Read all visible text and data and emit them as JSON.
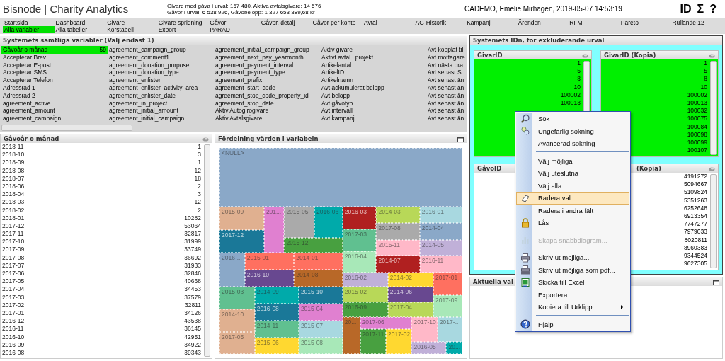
{
  "header": {
    "title": "Bisnode | Charity Analytics",
    "stats": [
      "Givare med gåva i urval: 167 480, Aktiva avtalsgivare: 14 576",
      "Gåvor i urval: 6 538 926, Gåvobelopp: 1 327 653 389,68 kr"
    ],
    "user": "CADEMO, Emelie Mirhagen, 2019-05-07 14:53:19",
    "tools": [
      "ID",
      "Σ",
      "?"
    ]
  },
  "tabs": [
    {
      "label": "Startsida",
      "selected": false
    },
    {
      "label": "Dashboard",
      "selected": false
    },
    {
      "label": "Givare",
      "selected": false
    },
    {
      "label": "Givare spridning",
      "selected": false
    },
    {
      "label": "Gåvor",
      "selected": false
    },
    {
      "label": "Gåvor, detalj",
      "selected": false
    },
    {
      "label": "Gåvor per konto",
      "selected": false
    },
    {
      "label": "Avtal",
      "selected": false
    },
    {
      "label": "AG-Historik",
      "selected": false
    },
    {
      "label": "Kampanj",
      "selected": false
    },
    {
      "label": "Ärenden",
      "selected": false
    },
    {
      "label": "RFM",
      "selected": false
    },
    {
      "label": "Pareto",
      "selected": false
    },
    {
      "label": "Rullande 12",
      "selected": false
    },
    {
      "label": "Alla variabler",
      "selected": true
    },
    {
      "label": "Alla tabeller",
      "selected": false
    },
    {
      "label": "Korstabell",
      "selected": false
    },
    {
      "label": "Export",
      "selected": false
    },
    {
      "label": "PARAD",
      "selected": false
    }
  ],
  "variables": {
    "title": "Systemets samtliga variabler (Välj endast 1)",
    "items": [
      {
        "label": "Gåvoår o månad",
        "count": "59",
        "selected": true
      },
      {
        "label": "Accepterar Brev",
        "selected": false
      },
      {
        "label": "Accepterar E-post",
        "selected": false
      },
      {
        "label": "Accepterar SMS",
        "selected": false
      },
      {
        "label": "Accepterar Telefon",
        "selected": false
      },
      {
        "label": "Adressrad 1",
        "selected": false
      },
      {
        "label": "Adressrad 2",
        "selected": false
      },
      {
        "label": "agreement_active",
        "selected": false
      },
      {
        "label": "agreement_amount",
        "selected": false
      },
      {
        "label": "agreement_campaign",
        "selected": false
      },
      {
        "label": "agreement_campaign_group",
        "selected": false
      },
      {
        "label": "agreement_comment1",
        "selected": false
      },
      {
        "label": "agreement_donation_purpose",
        "selected": false
      },
      {
        "label": "agreement_donation_type",
        "selected": false
      },
      {
        "label": "agreement_enlister",
        "selected": false
      },
      {
        "label": "agreement_enlister_activity_area",
        "selected": false
      },
      {
        "label": "agreement_enlister_date",
        "selected": false
      },
      {
        "label": "agreement_in_project",
        "selected": false
      },
      {
        "label": "agreement_initial_amount",
        "selected": false
      },
      {
        "label": "agreement_initial_campaign",
        "selected": false
      },
      {
        "label": "agreement_initial_campaign_group",
        "selected": false
      },
      {
        "label": "agreement_next_pay_yearmonth",
        "selected": false
      },
      {
        "label": "agreement_payment_interval",
        "selected": false
      },
      {
        "label": "agreement_payment_type",
        "selected": false
      },
      {
        "label": "agreement_prefix",
        "selected": false
      },
      {
        "label": "agreement_start_code",
        "selected": false
      },
      {
        "label": "agreement_stop_code_property_id",
        "selected": false
      },
      {
        "label": "agreement_stop_date",
        "selected": false
      },
      {
        "label": "Aktiv Autogirogivare",
        "selected": false
      },
      {
        "label": "Aktiv Avtalsgivare",
        "selected": false
      },
      {
        "label": "Aktiv givare",
        "selected": false
      },
      {
        "label": "Aktivt avtal i projekt",
        "selected": false
      },
      {
        "label": "Artikelantal",
        "selected": false
      },
      {
        "label": "ArtikelID",
        "selected": false
      },
      {
        "label": "Artikelnamn",
        "selected": false
      },
      {
        "label": "Avt ackumulerat belopp",
        "selected": false
      },
      {
        "label": "Avt belopp",
        "selected": false
      },
      {
        "label": "Avt gåvotyp",
        "selected": false
      },
      {
        "label": "Avt intervall",
        "selected": false
      },
      {
        "label": "Avt kampanj",
        "selected": false
      },
      {
        "label": "Avt kopplat til",
        "selected": false
      },
      {
        "label": "Avt mottagare",
        "selected": false
      },
      {
        "label": "Avt nästa dra",
        "selected": false
      },
      {
        "label": "Avt senast S",
        "selected": false
      },
      {
        "label": "Avt senast än",
        "selected": false
      },
      {
        "label": "Avt senast än",
        "selected": false
      },
      {
        "label": "Avt senast än",
        "selected": false
      },
      {
        "label": "Avt senast än",
        "selected": false
      },
      {
        "label": "Avt senast än",
        "selected": false
      },
      {
        "label": "Avt senast än",
        "selected": false
      }
    ]
  },
  "month_list": {
    "title": "Gåvoår o månad",
    "rows": [
      {
        "label": "2018-11",
        "count": "1"
      },
      {
        "label": "2018-10",
        "count": "3"
      },
      {
        "label": "2018-09",
        "count": "1"
      },
      {
        "label": "2018-08",
        "count": "12"
      },
      {
        "label": "2018-07",
        "count": "18"
      },
      {
        "label": "2018-06",
        "count": "2"
      },
      {
        "label": "2018-04",
        "count": "3"
      },
      {
        "label": "2018-03",
        "count": "12"
      },
      {
        "label": "2018-02",
        "count": "2"
      },
      {
        "label": "2018-01",
        "count": "10282"
      },
      {
        "label": "2017-12",
        "count": "53064"
      },
      {
        "label": "2017-11",
        "count": "32817"
      },
      {
        "label": "2017-10",
        "count": "31999"
      },
      {
        "label": "2017-09",
        "count": "33749"
      },
      {
        "label": "2017-08",
        "count": "36692"
      },
      {
        "label": "2017-07",
        "count": "31933"
      },
      {
        "label": "2017-06",
        "count": "32846"
      },
      {
        "label": "2017-05",
        "count": "40668"
      },
      {
        "label": "2017-04",
        "count": "34453"
      },
      {
        "label": "2017-03",
        "count": "37579"
      },
      {
        "label": "2017-02",
        "count": "32811"
      },
      {
        "label": "2017-01",
        "count": "34126"
      },
      {
        "label": "2016-12",
        "count": "43538"
      },
      {
        "label": "2016-11",
        "count": "36145"
      },
      {
        "label": "2016-10",
        "count": "42951"
      },
      {
        "label": "2016-09",
        "count": "34922"
      },
      {
        "label": "2016-08",
        "count": "39343"
      }
    ]
  },
  "treemap": {
    "title": "Fördelning värden i variabeln",
    "tiles": [
      {
        "label": "<NULL>",
        "color": "#8aa8c8"
      },
      {
        "label": "2015-09",
        "color": "#e0b090"
      },
      {
        "label": "201...",
        "color": "#e080d0"
      },
      {
        "label": "2015-05",
        "color": "#aaaaaa"
      },
      {
        "label": "2016-06",
        "color": "#00aaaa"
      },
      {
        "label": "2016-03",
        "color": "#b02020"
      },
      {
        "label": "2014-03",
        "color": "#b8d858"
      },
      {
        "label": "2016-01",
        "color": "#a8d8e0"
      },
      {
        "label": "2017-12",
        "color": "#1a7898"
      },
      {
        "label": "2015-12",
        "color": "#48a040"
      },
      {
        "label": "2017-03",
        "color": "#60c090"
      },
      {
        "label": "2017-08",
        "color": "#aaaaaa"
      },
      {
        "label": "2014-04",
        "color": "#8aa8c8"
      },
      {
        "label": "2015-11",
        "color": "#ffb8c8"
      },
      {
        "label": "2014-05",
        "color": "#c0b0d8"
      },
      {
        "label": "2016-...",
        "color": "#8aa8c8"
      },
      {
        "label": "2015-01",
        "color": "#ff7060"
      },
      {
        "label": "2014-01",
        "color": "#ff7060"
      },
      {
        "label": "2016-04",
        "color": "#a8e8b8"
      },
      {
        "label": "2014-07",
        "color": "#b02020"
      },
      {
        "label": "2016-11",
        "color": "#ffb8c8"
      },
      {
        "label": "2016-10",
        "color": "#684890"
      },
      {
        "label": "2014-08",
        "color": "#b86828"
      },
      {
        "label": "2016-02",
        "color": "#c0b0d8"
      },
      {
        "label": "2014-02",
        "color": "#ffd830"
      },
      {
        "label": "2017-01",
        "color": "#ff7060"
      },
      {
        "label": "2015-03",
        "color": "#60c090"
      },
      {
        "label": "2014-09",
        "color": "#00aaaa"
      },
      {
        "label": "2015-10",
        "color": "#1a7898"
      },
      {
        "label": "2015-02",
        "color": "#b8d858"
      },
      {
        "label": "2014-06",
        "color": "#684890"
      },
      {
        "label": "2017-09",
        "color": "#a8e8b8"
      },
      {
        "label": "2016-08",
        "color": "#1a7898"
      },
      {
        "label": "2015-04",
        "color": "#e080d0"
      },
      {
        "label": "2016-09",
        "color": "#48a040"
      },
      {
        "label": "2017-04",
        "color": "#b8d858"
      },
      {
        "label": "2014-10",
        "color": "#e0b090"
      },
      {
        "label": "20...",
        "color": "#b86828"
      },
      {
        "label": "2017-06",
        "color": "#e080d0"
      },
      {
        "label": "2017-10",
        "color": "#ffb8c8"
      },
      {
        "label": "2017-...",
        "color": "#a8d8e0"
      },
      {
        "label": "2014-11",
        "color": "#60c090"
      },
      {
        "label": "2015-07",
        "color": "#a8d8e0"
      },
      {
        "label": "2017-11",
        "color": "#48a040"
      },
      {
        "label": "2017-02",
        "color": "#ffd830"
      },
      {
        "label": "2017-05",
        "color": "#e0b090"
      },
      {
        "label": "2015-06",
        "color": "#ffd830"
      },
      {
        "label": "2015-08",
        "color": "#a8e8b8"
      },
      {
        "label": "2016-05",
        "color": "#c0b0d8"
      },
      {
        "label": "20...",
        "color": "#00aaaa"
      }
    ]
  },
  "id_panel": {
    "title": "Systemets IDn, för exkluderande urval",
    "boxes": [
      {
        "title": "GivarID",
        "selected": true,
        "values": [
          "1",
          "5",
          "8",
          "10",
          "100002",
          "100013"
        ]
      },
      {
        "title": "GivarID (Kopia)",
        "selected": true,
        "values": [
          "1",
          "5",
          "8",
          "10",
          "100002",
          "100013",
          "100032",
          "100075",
          "100084",
          "100098",
          "100099",
          "100107"
        ]
      },
      {
        "title": "GåvoID",
        "selected": false
      },
      {
        "title": "(Kopia)",
        "selected": false,
        "values": [
          "4191272",
          "5094667",
          "5109824",
          "5351263",
          "6252648",
          "6913354",
          "7747277",
          "7979033",
          "8020811",
          "8960383",
          "9344524",
          "9627305"
        ]
      }
    ]
  },
  "current_selections": {
    "title": "Aktuella val"
  },
  "context_menu": {
    "items": [
      {
        "kind": "item",
        "label": "Sök",
        "selected": false,
        "disabled": false
      },
      {
        "kind": "item",
        "label": "Ungefärlig sökning",
        "selected": false,
        "disabled": false
      },
      {
        "kind": "item",
        "label": "Avancerad sökning",
        "selected": false,
        "disabled": false
      },
      {
        "kind": "separator"
      },
      {
        "kind": "item",
        "label": "Välj möjliga",
        "selected": false,
        "disabled": false
      },
      {
        "kind": "item",
        "label": "Välj uteslutna",
        "selected": false,
        "disabled": false
      },
      {
        "kind": "item",
        "label": "Välj alla",
        "selected": false,
        "disabled": false
      },
      {
        "kind": "item",
        "label": "Radera val",
        "selected": true,
        "disabled": false
      },
      {
        "kind": "item",
        "label": "Radera i andra fält",
        "selected": false,
        "disabled": false
      },
      {
        "kind": "item",
        "label": "Lås",
        "selected": false,
        "disabled": false
      },
      {
        "kind": "separator"
      },
      {
        "kind": "item",
        "label": "Skapa snabbdiagram...",
        "selected": false,
        "disabled": true
      },
      {
        "kind": "separator"
      },
      {
        "kind": "item",
        "label": "Skriv ut möjliga...",
        "selected": false,
        "disabled": false
      },
      {
        "kind": "item",
        "label": "Skriv ut möjliga som pdf...",
        "selected": false,
        "disabled": false
      },
      {
        "kind": "item",
        "label": "Skicka till Excel",
        "selected": false,
        "disabled": false
      },
      {
        "kind": "item",
        "label": "Exportera...",
        "selected": false,
        "disabled": false
      },
      {
        "kind": "item",
        "label": "Kopiera till Urklipp",
        "selected": false,
        "disabled": false,
        "submenu": true
      },
      {
        "kind": "separator"
      },
      {
        "kind": "item",
        "label": "Hjälp",
        "selected": false,
        "disabled": false
      }
    ]
  }
}
